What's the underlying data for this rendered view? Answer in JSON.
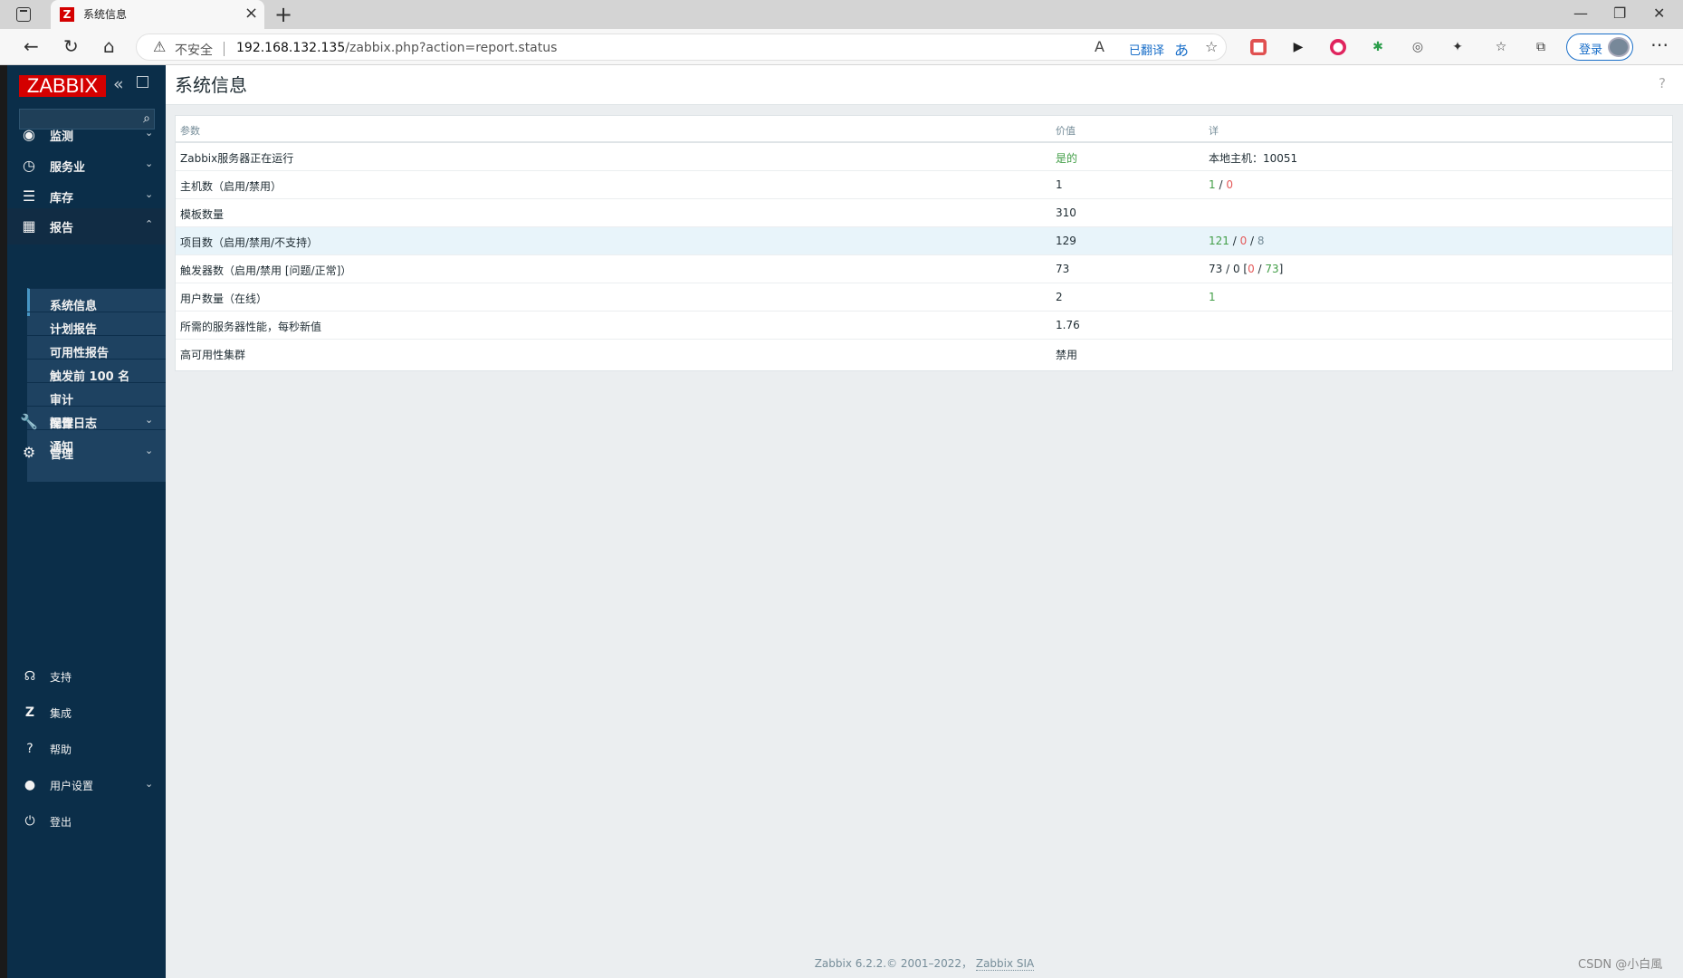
{
  "browser": {
    "tab_title": "系统信息",
    "tab_favicon": "Z",
    "address_warning": "不安全",
    "url_host": "192.168.132.135",
    "url_path": "/zabbix.php?action=report.status",
    "translated": "已翻译",
    "login_label": "登录"
  },
  "sidebar": {
    "logo": "ZABBIX",
    "search_placeholder": "",
    "menu": [
      {
        "label": "监测",
        "icon": "eye-icon"
      },
      {
        "label": "服务业",
        "icon": "clock-icon"
      },
      {
        "label": "库存",
        "icon": "list-icon"
      },
      {
        "label": "报告",
        "icon": "report-icon"
      },
      {
        "label": "配置",
        "icon": "wrench-icon"
      },
      {
        "label": "管理",
        "icon": "gear-icon"
      }
    ],
    "submenu": [
      {
        "label": "系统信息"
      },
      {
        "label": "计划报告"
      },
      {
        "label": "可用性报告"
      },
      {
        "label": "触发前 100 名"
      },
      {
        "label": "审计"
      },
      {
        "label": "操作日志"
      },
      {
        "label": "通知"
      }
    ],
    "footer": [
      {
        "label": "支持",
        "icon": "headset-icon"
      },
      {
        "label": "集成",
        "icon": "zabbix-icon"
      },
      {
        "label": "帮助",
        "icon": "question-icon"
      },
      {
        "label": "用户设置",
        "icon": "user-icon"
      },
      {
        "label": "登出",
        "icon": "power-icon"
      }
    ]
  },
  "page": {
    "title": "系统信息",
    "help": "?"
  },
  "table": {
    "headers": [
      "参数",
      "价值",
      "详"
    ],
    "rows": [
      {
        "param": "Zabbix服务器正在运行",
        "value": "是的",
        "detail": "本地主机：10051"
      },
      {
        "param": "主机数（启用/禁用）",
        "value": "1",
        "d1": "1",
        "d2": "0"
      },
      {
        "param": "模板数量",
        "value": "310",
        "detail": ""
      },
      {
        "param": "项目数（启用/禁用/不支持）",
        "value": "129",
        "d1": "121",
        "d2": "0",
        "d3": "8"
      },
      {
        "param": "触发器数（启用/禁用 [问题/正常]）",
        "value": "73",
        "d1": "73 / 0 [",
        "d2": "0",
        "d3": "73",
        "d4": "]"
      },
      {
        "param": "用户数量（在线）",
        "value": "2",
        "d1": "1"
      },
      {
        "param": "所需的服务器性能，每秒新值",
        "value": "1.76",
        "detail": ""
      },
      {
        "param": "高可用性集群",
        "value": "禁用",
        "detail": ""
      }
    ]
  },
  "footer": {
    "text": "Zabbix 6.2.2.© 2001–2022，",
    "link": "Zabbix SIA"
  },
  "watermark": "CSDN @小白風",
  "colors": {
    "sidebar_bg": "#0b2e49",
    "submenu_bg": "#1e4261",
    "logo_red": "#d40000",
    "ok_green": "#429e47",
    "problem_red": "#e45959"
  }
}
